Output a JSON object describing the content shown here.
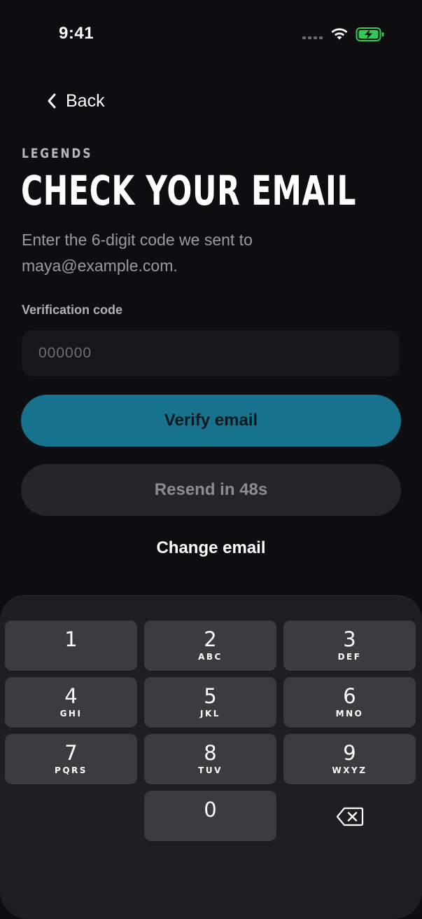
{
  "status_bar": {
    "time": "9:41",
    "icons": [
      "cellular-signal-icon",
      "wifi-icon",
      "battery-charging-icon"
    ],
    "battery_color": "#34c759"
  },
  "nav": {
    "back_label": "Back",
    "back_icon": "chevron-left-icon"
  },
  "header": {
    "brand": "LEGENDS",
    "title": "CHECK YOUR EMAIL",
    "subtitle": "Enter the 6-digit code we sent to maya@example.com."
  },
  "form": {
    "code_label": "Verification code",
    "code_placeholder": "000000",
    "code_value": "",
    "verify_label": "Verify email",
    "resend_label": "Resend in 48s",
    "change_email_label": "Change email"
  },
  "colors": {
    "background": "#0e0e10",
    "accent": "#17728e",
    "muted_button": "#25252a",
    "keypad_background": "#1f1f21",
    "key_background": "#3c3c3f"
  },
  "keypad": {
    "keys": [
      {
        "digit": "1",
        "letters": ""
      },
      {
        "digit": "2",
        "letters": "ABC"
      },
      {
        "digit": "3",
        "letters": "DEF"
      },
      {
        "digit": "4",
        "letters": "GHI"
      },
      {
        "digit": "5",
        "letters": "JKL"
      },
      {
        "digit": "6",
        "letters": "MNO"
      },
      {
        "digit": "7",
        "letters": "PQRS"
      },
      {
        "digit": "8",
        "letters": "TUV"
      },
      {
        "digit": "9",
        "letters": "WXYZ"
      },
      {
        "digit": "0",
        "letters": ""
      }
    ],
    "delete_icon": "backspace-icon"
  }
}
